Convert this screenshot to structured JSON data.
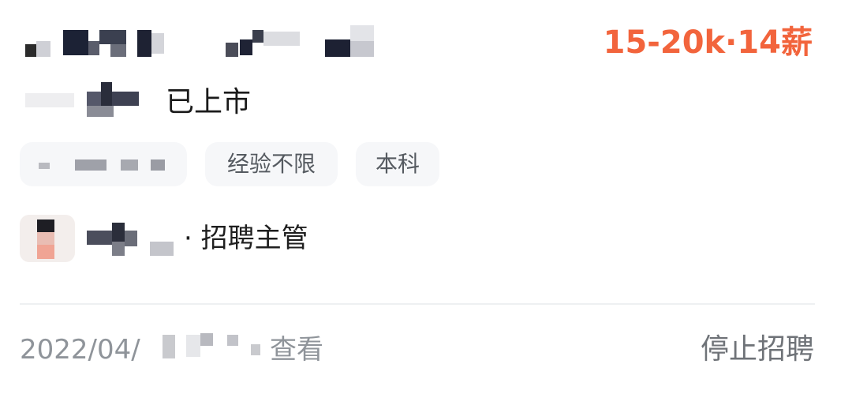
{
  "job": {
    "salary": "15-20k·14薪",
    "company_status": "已上市",
    "tags": [
      {
        "label": ""
      },
      {
        "label": "经验不限"
      },
      {
        "label": "本科"
      }
    ]
  },
  "recruiter": {
    "role": "· 招聘主管"
  },
  "footer": {
    "date_prefix": "2022/04/",
    "view_label": "查看",
    "stop_label": "停止招聘"
  },
  "colors": {
    "salary": "#f2643c",
    "tag_bg": "#f6f7f9",
    "muted_text": "#8f949a"
  }
}
